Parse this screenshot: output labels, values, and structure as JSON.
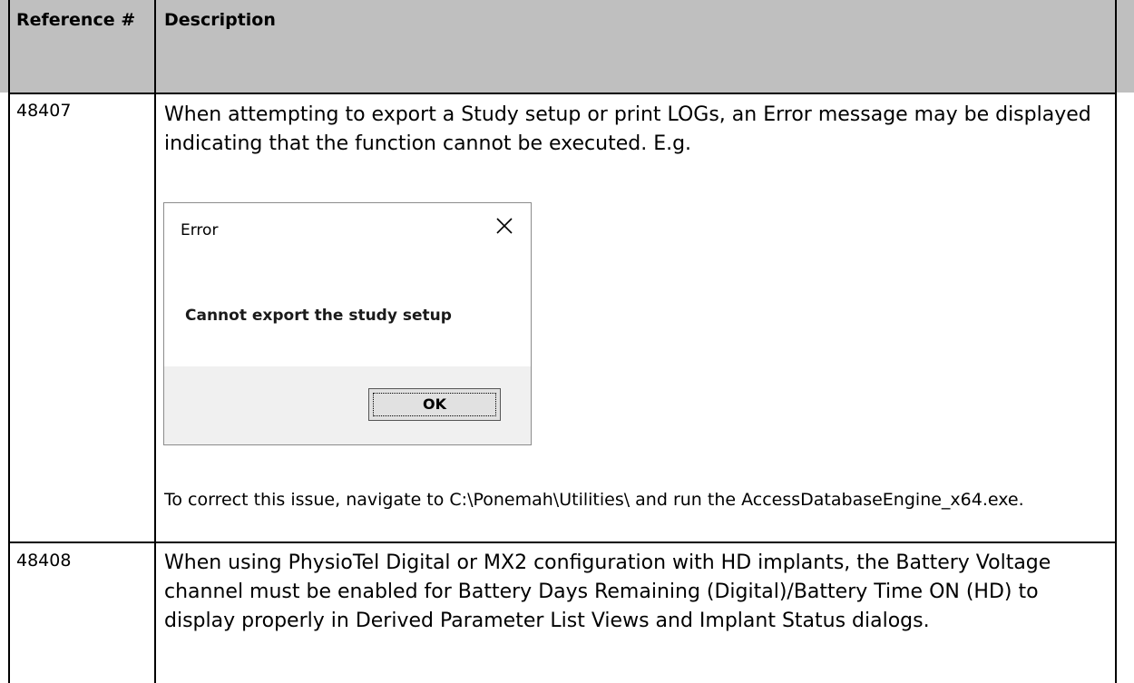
{
  "table": {
    "header": {
      "reference": "Reference #",
      "description": "Description"
    },
    "rows": [
      {
        "reference": "48407",
        "text1": "When attempting to export a Study setup or print LOGs, an Error message may be displayed indicating that the function cannot be executed. E.g.",
        "text2": "To correct this issue, navigate to C:\\Ponemah\\Utilities\\ and run the AccessDatabaseEngine_x64.exe."
      },
      {
        "reference": "48408",
        "text1": "When using PhysioTel Digital or MX2 configuration with HD implants, the Battery Voltage channel must be enabled for Battery Days Remaining (Digital)/Battery Time ON (HD) to display properly in Derived Parameter List Views and Implant Status dialogs."
      }
    ]
  },
  "dialog": {
    "title": "Error",
    "message": "Cannot export the study setup",
    "ok_label": "OK",
    "close_icon": "close-icon"
  }
}
